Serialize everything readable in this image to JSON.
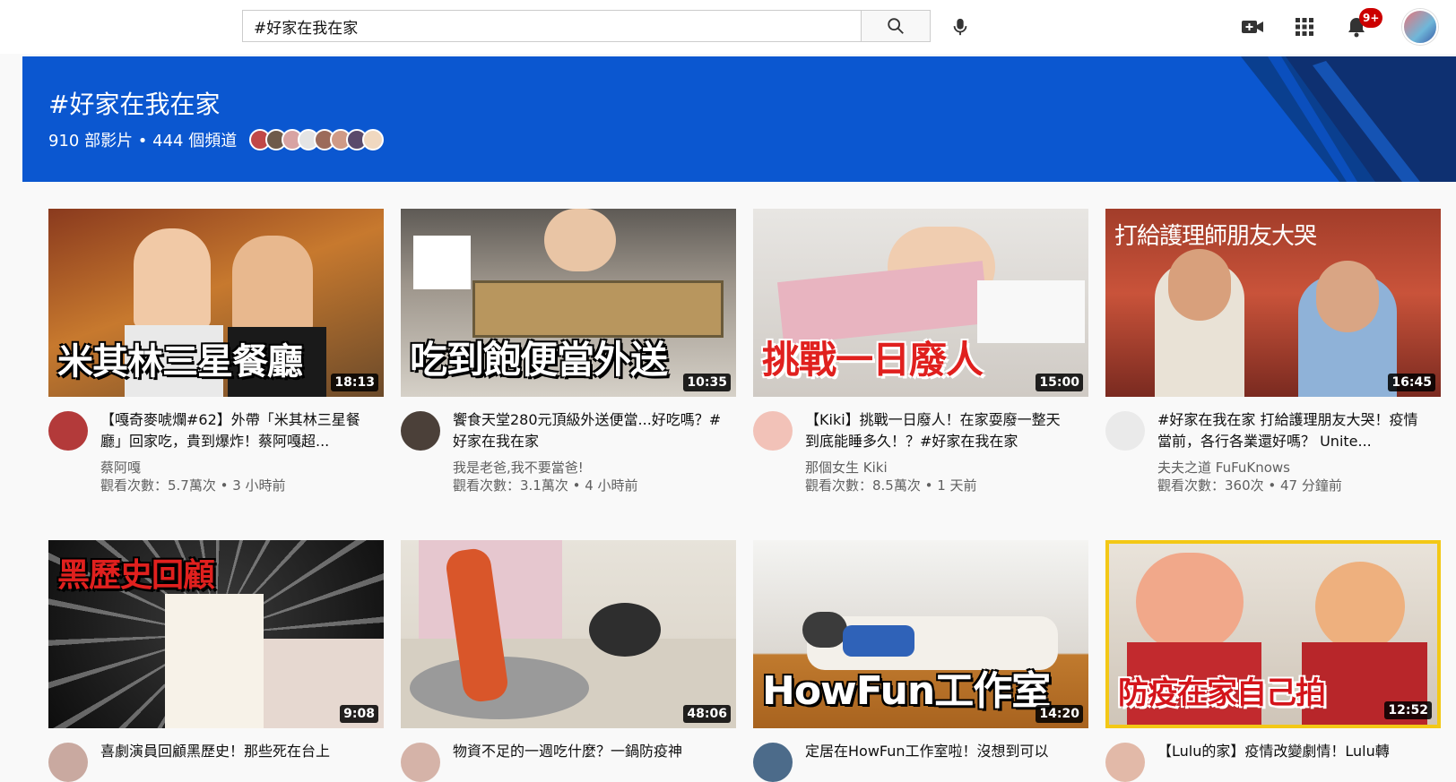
{
  "search": {
    "value": "#好家在我在家"
  },
  "notifications": {
    "badge": "9+"
  },
  "banner": {
    "title": "#好家在我在家",
    "stats": "910 部影片 • 444 個頻道",
    "accent_color": "#0b57d0"
  },
  "videos": [
    {
      "title": "【嘎奇麥唬爛#62】外帶「米其林三星餐廳」回家吃，貴到爆炸！蔡阿嘎超...",
      "channel": "蔡阿嘎",
      "meta": "觀看次數：5.7萬次 • 3 小時前",
      "duration": "18:13",
      "thumb_text": "米其林三星餐廳"
    },
    {
      "title": "饗食天堂280元頂級外送便當...好吃嗎？#好家在我在家",
      "channel": "我是老爸,我不要當爸!",
      "meta": "觀看次數：3.1萬次 • 4 小時前",
      "duration": "10:35",
      "thumb_text": "吃到飽便當外送"
    },
    {
      "title": "【Kiki】挑戰一日廢人！在家耍廢一整天到底能睡多久！？#好家在我在家",
      "channel": "那個女生 Kiki",
      "meta": "觀看次數：8.5萬次 • 1 天前",
      "duration": "15:00",
      "thumb_text": "挑戰一日廢人"
    },
    {
      "title": "#好家在我在家 打給護理朋友大哭！疫情當前，各行各業還好嗎？ Unite...",
      "channel": "夫夫之道 FuFuKnows",
      "meta": "觀看次數：360次 • 47 分鐘前",
      "duration": "16:45",
      "thumb_text": "打給護理師朋友大哭"
    },
    {
      "title": "喜劇演員回顧黑歷史！那些死在台上",
      "channel": "",
      "meta": "",
      "duration": "9:08",
      "thumb_text": "黑歷史回顧"
    },
    {
      "title": "物資不足的一週吃什麼？一鍋防疫神",
      "channel": "",
      "meta": "",
      "duration": "48:06",
      "thumb_text": ""
    },
    {
      "title": "定居在HowFun工作室啦！沒想到可以",
      "channel": "",
      "meta": "",
      "duration": "14:20",
      "thumb_text": "HowFun工作室"
    },
    {
      "title": "【Lulu的家】疫情改變劇情！Lulu轉",
      "channel": "",
      "meta": "",
      "duration": "12:52",
      "thumb_text": "防疫在家自己拍"
    }
  ]
}
